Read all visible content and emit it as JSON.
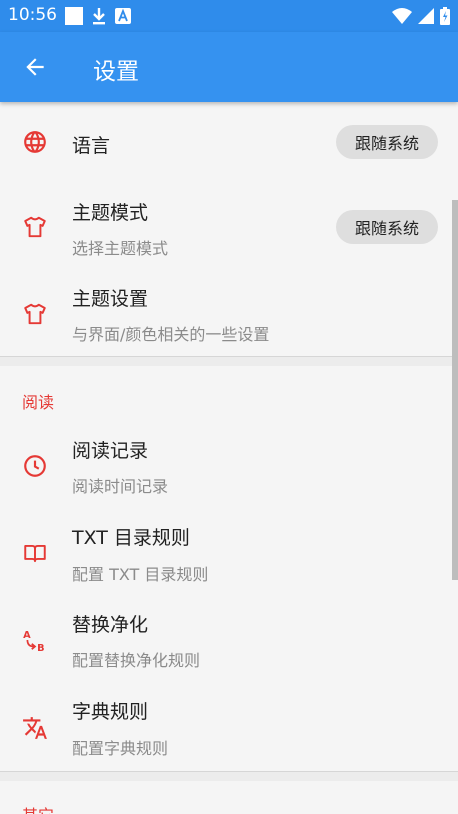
{
  "status_bar": {
    "time": "10:56",
    "icons_left": [
      "square-icon",
      "download-icon",
      "text-a-icon"
    ],
    "icons_right": [
      "wifi-icon",
      "signal-icon",
      "battery-icon"
    ]
  },
  "app_bar": {
    "title": "设置",
    "back_icon": "arrow-back-icon"
  },
  "colors": {
    "primary": "#3592f0",
    "status_bar": "#2f8ceb",
    "accent_red": "#e53935",
    "chip_bg": "#dedede",
    "background": "#f5f5f5"
  },
  "settings": {
    "language": {
      "title": "语言",
      "value": "跟随系统",
      "icon": "globe-icon"
    },
    "theme_mode": {
      "title": "主题模式",
      "subtitle": "选择主题模式",
      "value": "跟随系统",
      "icon": "tshirt-icon"
    },
    "theme_settings": {
      "title": "主题设置",
      "subtitle": "与界面/颜色相关的一些设置",
      "icon": "tshirt-icon"
    }
  },
  "reading": {
    "header": "阅读",
    "items": [
      {
        "title": "阅读记录",
        "subtitle": "阅读时间记录",
        "icon": "clock-icon"
      },
      {
        "title": "TXT 目录规则",
        "subtitle": "配置 TXT 目录规则",
        "icon": "book-icon"
      },
      {
        "title": "替换净化",
        "subtitle": "配置替换净化规则",
        "icon": "replace-icon"
      },
      {
        "title": "字典规则",
        "subtitle": "配置字典规则",
        "icon": "translate-icon"
      }
    ]
  },
  "other": {
    "header": "其它"
  }
}
